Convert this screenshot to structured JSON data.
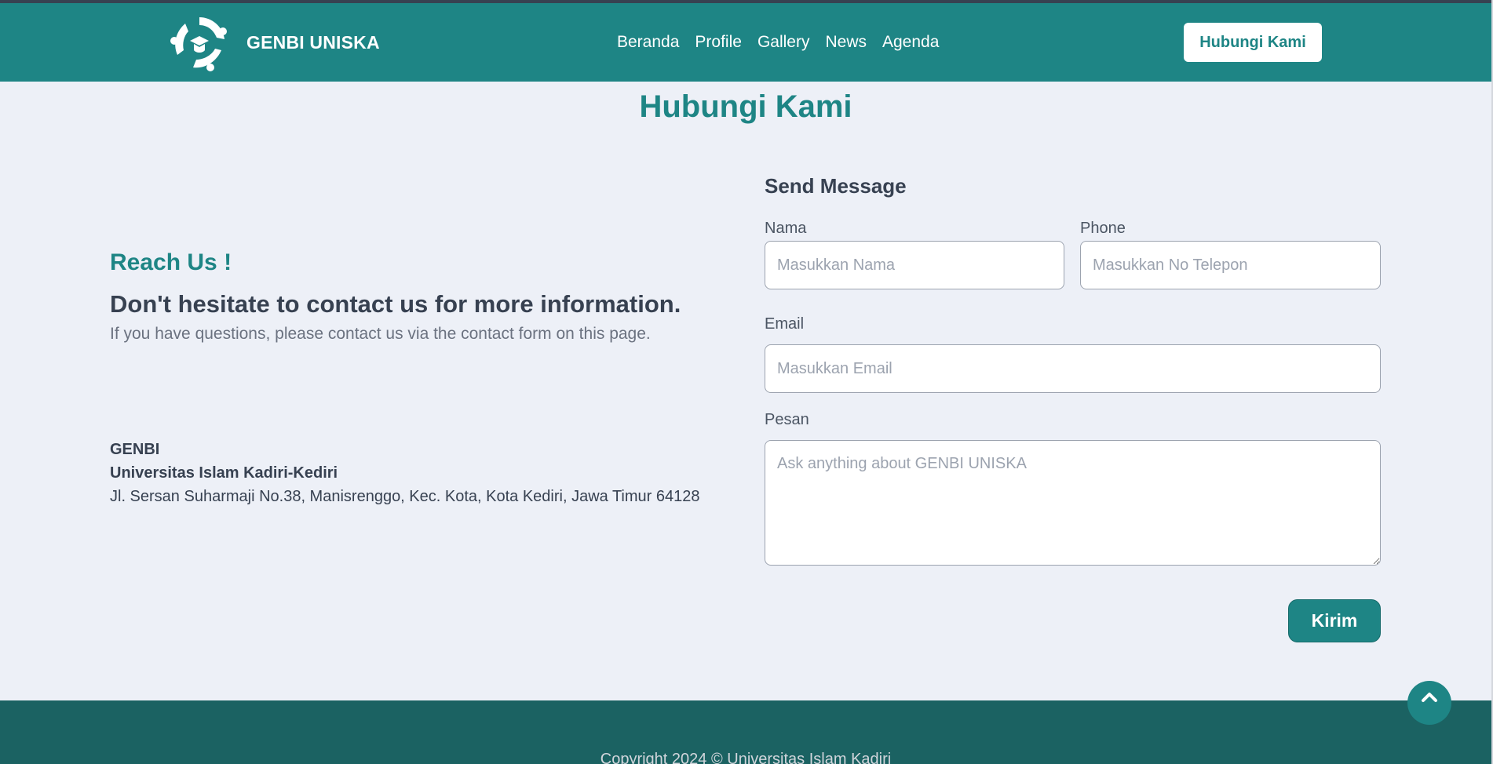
{
  "header": {
    "brand_name": "GENBI UNISKA",
    "nav": [
      "Beranda",
      "Profile",
      "Gallery",
      "News",
      "Agenda"
    ],
    "cta_label": "Hubungi Kami"
  },
  "page_title": "Hubungi Kami",
  "reach": {
    "title": "Reach Us !",
    "heading": "Don't hesitate to contact us for more information.",
    "description": "If you have questions, please contact us via the contact form on this page."
  },
  "address": {
    "org": "GENBI",
    "university": "Universitas Islam Kadiri-Kediri",
    "street": "Jl. Sersan Suharmaji No.38, Manisrenggo, Kec. Kota, Kota Kediri, Jawa Timur 64128"
  },
  "form": {
    "title": "Send Message",
    "name_label": "Nama",
    "name_placeholder": "Masukkan Nama",
    "phone_label": "Phone",
    "phone_placeholder": "Masukkan No Telepon",
    "email_label": "Email",
    "email_placeholder": "Masukkan Email",
    "message_label": "Pesan",
    "message_placeholder": "Ask anything about GENBI UNISKA",
    "submit_label": "Kirim"
  },
  "footer": {
    "copyright": "Copyright 2024 © Universitas Islam Kadiri"
  },
  "colors": {
    "primary": "#1e8585",
    "footer": "#1b6262",
    "background": "#edf0f7",
    "text": "#374151"
  },
  "icons": {
    "logo": "genbi-logo-icon",
    "scroll_top": "chevron-up-icon"
  }
}
